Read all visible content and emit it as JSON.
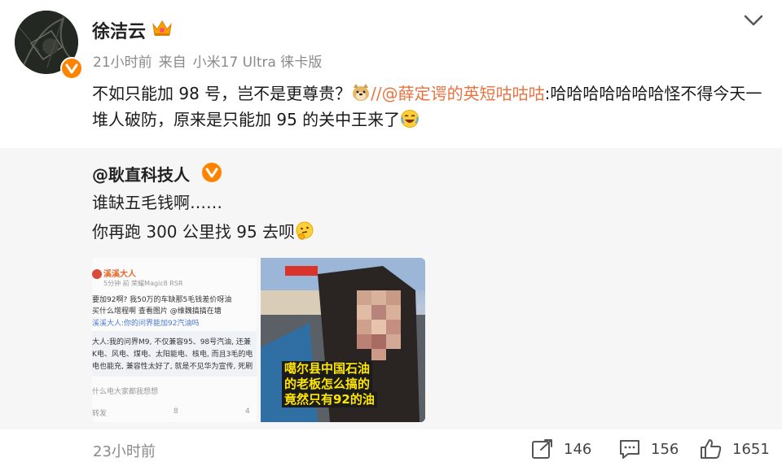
{
  "post": {
    "author": "徐洁云",
    "time": "21小时前",
    "source_prefix": "来自",
    "device": "小米17 Ultra 徕卡版",
    "text_a": "不如只能加 98 号，岂不是更尊贵？",
    "text_b": "//",
    "text_mention": "@薛定谔的英短咕咕咕",
    "text_c": ":哈哈哈哈哈哈哈怪不得今天一堆人破防，原来是只能加 95 的关中王来了"
  },
  "repost": {
    "author": "@耿直科技人",
    "line1": "谁缺五毛钱啊……",
    "line2": "你再跑 300 公里找 95 去呗",
    "image1": {
      "user": "溪溪大人",
      "meta": "5分钟 前 荣耀Magic8 RSR",
      "l1": "要加92啊? 我50万的车缺那5毛钱差价呀",
      "l1b": "油",
      "l2": "买什么增程啊",
      "l2b": "查看图片",
      "l2c": "@维魏搞搞在塘",
      "l3": "溪溪大人:你的问界能加92汽油吗",
      "l4": "大人:我的问界M9, 不仅兼容95、98号汽油, 还兼",
      "l5": "K电、风电、煤电、太阳能电、核电, 而且3毛的电",
      "l6": "电也能充, 兼容性太好了, 就是不见华为宣传, 死刷",
      "l7": "什么电大家都我想想",
      "f1": "转发",
      "f2": "8",
      "f3": "4"
    },
    "image2": {
      "caption1": "噶尔县中国石油",
      "caption2": "的老板怎么搞的",
      "caption3": "竟然只有92的油"
    }
  },
  "footer": {
    "time": "23小时前",
    "reposts": "146",
    "comments": "156",
    "likes": "1651"
  },
  "colors": {
    "accent_orange": "#ff8200",
    "mention": "#eb7340",
    "meta_gray": "#8a8a8a",
    "repost_bg": "#f6f6f6"
  },
  "icons": [
    "crown-icon",
    "verified-badge-icon",
    "chevron-down-icon",
    "laugh-emoji-icon",
    "doge-emoji-icon",
    "thinking-emoji-icon",
    "repost-icon",
    "comment-icon",
    "like-icon"
  ]
}
